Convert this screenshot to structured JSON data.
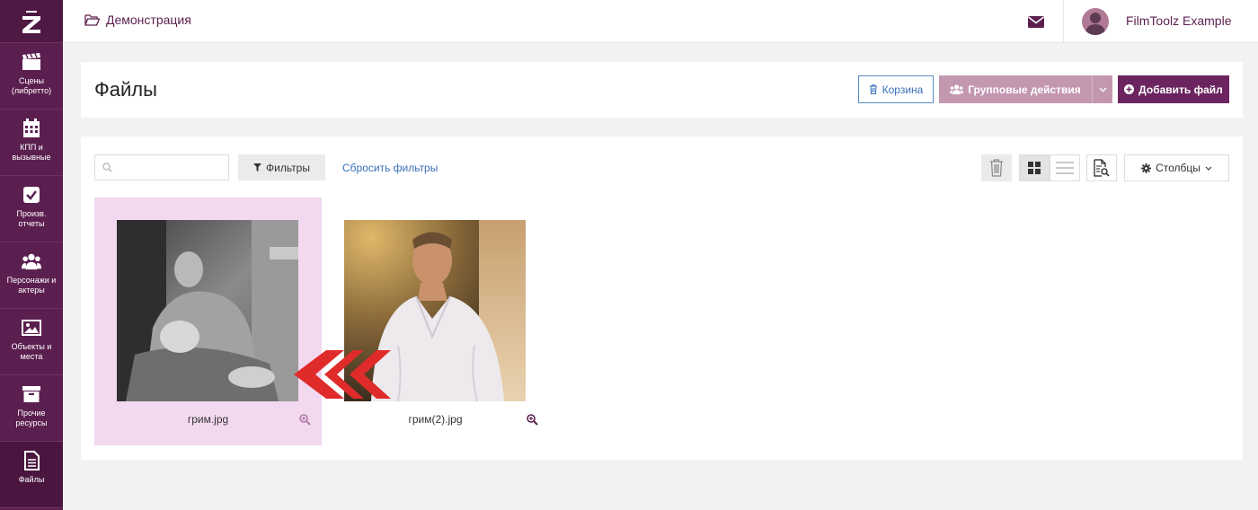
{
  "app": {
    "logo_letter": "Z",
    "accent": "#5b1f4f"
  },
  "sidebar": {
    "items": [
      {
        "label": "Сцены\n(либретто)",
        "icon": "clapperboard-icon"
      },
      {
        "label": "КПП и\nвызывные",
        "icon": "calendar-icon"
      },
      {
        "label": "Произв.\nотчеты",
        "icon": "checkbox-icon"
      },
      {
        "label": "Персонажи и\nактеры",
        "icon": "users-icon"
      },
      {
        "label": "Объекты и\nместа",
        "icon": "image-icon"
      },
      {
        "label": "Прочие\nресурсы",
        "icon": "archive-icon"
      },
      {
        "label": "Файлы",
        "icon": "file-icon"
      }
    ]
  },
  "topbar": {
    "breadcrumb": "Демонстрация",
    "user_name": "FilmToolz Example"
  },
  "header": {
    "title": "Файлы",
    "trash_label": "Корзина",
    "group_actions_label": "Групповые действия",
    "add_file_label": "Добавить файл"
  },
  "toolbar": {
    "search_placeholder": "",
    "filters_label": "Фильтры",
    "reset_filters_label": "Сбросить фильтры",
    "columns_label": "Столбцы"
  },
  "files": [
    {
      "name": "грим.jpg",
      "selected": true
    },
    {
      "name": "грим(2).jpg",
      "selected": false
    }
  ]
}
